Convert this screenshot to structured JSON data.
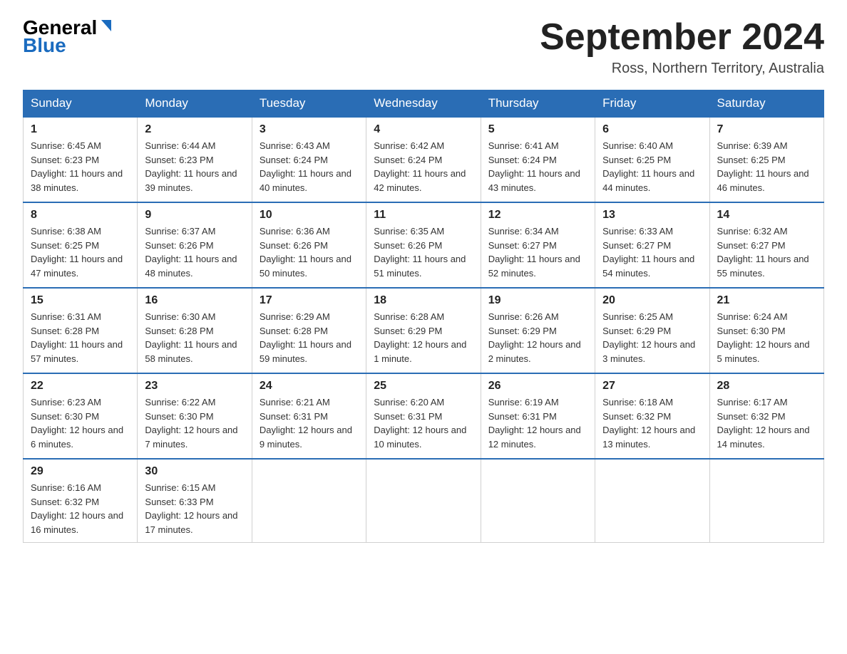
{
  "header": {
    "logo_text_black": "General",
    "logo_text_blue": "Blue",
    "month_title": "September 2024",
    "location": "Ross, Northern Territory, Australia"
  },
  "days_of_week": [
    "Sunday",
    "Monday",
    "Tuesday",
    "Wednesday",
    "Thursday",
    "Friday",
    "Saturday"
  ],
  "weeks": [
    [
      {
        "day": "1",
        "sunrise": "6:45 AM",
        "sunset": "6:23 PM",
        "daylight": "11 hours and 38 minutes."
      },
      {
        "day": "2",
        "sunrise": "6:44 AM",
        "sunset": "6:23 PM",
        "daylight": "11 hours and 39 minutes."
      },
      {
        "day": "3",
        "sunrise": "6:43 AM",
        "sunset": "6:24 PM",
        "daylight": "11 hours and 40 minutes."
      },
      {
        "day": "4",
        "sunrise": "6:42 AM",
        "sunset": "6:24 PM",
        "daylight": "11 hours and 42 minutes."
      },
      {
        "day": "5",
        "sunrise": "6:41 AM",
        "sunset": "6:24 PM",
        "daylight": "11 hours and 43 minutes."
      },
      {
        "day": "6",
        "sunrise": "6:40 AM",
        "sunset": "6:25 PM",
        "daylight": "11 hours and 44 minutes."
      },
      {
        "day": "7",
        "sunrise": "6:39 AM",
        "sunset": "6:25 PM",
        "daylight": "11 hours and 46 minutes."
      }
    ],
    [
      {
        "day": "8",
        "sunrise": "6:38 AM",
        "sunset": "6:25 PM",
        "daylight": "11 hours and 47 minutes."
      },
      {
        "day": "9",
        "sunrise": "6:37 AM",
        "sunset": "6:26 PM",
        "daylight": "11 hours and 48 minutes."
      },
      {
        "day": "10",
        "sunrise": "6:36 AM",
        "sunset": "6:26 PM",
        "daylight": "11 hours and 50 minutes."
      },
      {
        "day": "11",
        "sunrise": "6:35 AM",
        "sunset": "6:26 PM",
        "daylight": "11 hours and 51 minutes."
      },
      {
        "day": "12",
        "sunrise": "6:34 AM",
        "sunset": "6:27 PM",
        "daylight": "11 hours and 52 minutes."
      },
      {
        "day": "13",
        "sunrise": "6:33 AM",
        "sunset": "6:27 PM",
        "daylight": "11 hours and 54 minutes."
      },
      {
        "day": "14",
        "sunrise": "6:32 AM",
        "sunset": "6:27 PM",
        "daylight": "11 hours and 55 minutes."
      }
    ],
    [
      {
        "day": "15",
        "sunrise": "6:31 AM",
        "sunset": "6:28 PM",
        "daylight": "11 hours and 57 minutes."
      },
      {
        "day": "16",
        "sunrise": "6:30 AM",
        "sunset": "6:28 PM",
        "daylight": "11 hours and 58 minutes."
      },
      {
        "day": "17",
        "sunrise": "6:29 AM",
        "sunset": "6:28 PM",
        "daylight": "11 hours and 59 minutes."
      },
      {
        "day": "18",
        "sunrise": "6:28 AM",
        "sunset": "6:29 PM",
        "daylight": "12 hours and 1 minute."
      },
      {
        "day": "19",
        "sunrise": "6:26 AM",
        "sunset": "6:29 PM",
        "daylight": "12 hours and 2 minutes."
      },
      {
        "day": "20",
        "sunrise": "6:25 AM",
        "sunset": "6:29 PM",
        "daylight": "12 hours and 3 minutes."
      },
      {
        "day": "21",
        "sunrise": "6:24 AM",
        "sunset": "6:30 PM",
        "daylight": "12 hours and 5 minutes."
      }
    ],
    [
      {
        "day": "22",
        "sunrise": "6:23 AM",
        "sunset": "6:30 PM",
        "daylight": "12 hours and 6 minutes."
      },
      {
        "day": "23",
        "sunrise": "6:22 AM",
        "sunset": "6:30 PM",
        "daylight": "12 hours and 7 minutes."
      },
      {
        "day": "24",
        "sunrise": "6:21 AM",
        "sunset": "6:31 PM",
        "daylight": "12 hours and 9 minutes."
      },
      {
        "day": "25",
        "sunrise": "6:20 AM",
        "sunset": "6:31 PM",
        "daylight": "12 hours and 10 minutes."
      },
      {
        "day": "26",
        "sunrise": "6:19 AM",
        "sunset": "6:31 PM",
        "daylight": "12 hours and 12 minutes."
      },
      {
        "day": "27",
        "sunrise": "6:18 AM",
        "sunset": "6:32 PM",
        "daylight": "12 hours and 13 minutes."
      },
      {
        "day": "28",
        "sunrise": "6:17 AM",
        "sunset": "6:32 PM",
        "daylight": "12 hours and 14 minutes."
      }
    ],
    [
      {
        "day": "29",
        "sunrise": "6:16 AM",
        "sunset": "6:32 PM",
        "daylight": "12 hours and 16 minutes."
      },
      {
        "day": "30",
        "sunrise": "6:15 AM",
        "sunset": "6:33 PM",
        "daylight": "12 hours and 17 minutes."
      },
      null,
      null,
      null,
      null,
      null
    ]
  ],
  "labels": {
    "sunrise": "Sunrise:",
    "sunset": "Sunset:",
    "daylight": "Daylight:"
  }
}
